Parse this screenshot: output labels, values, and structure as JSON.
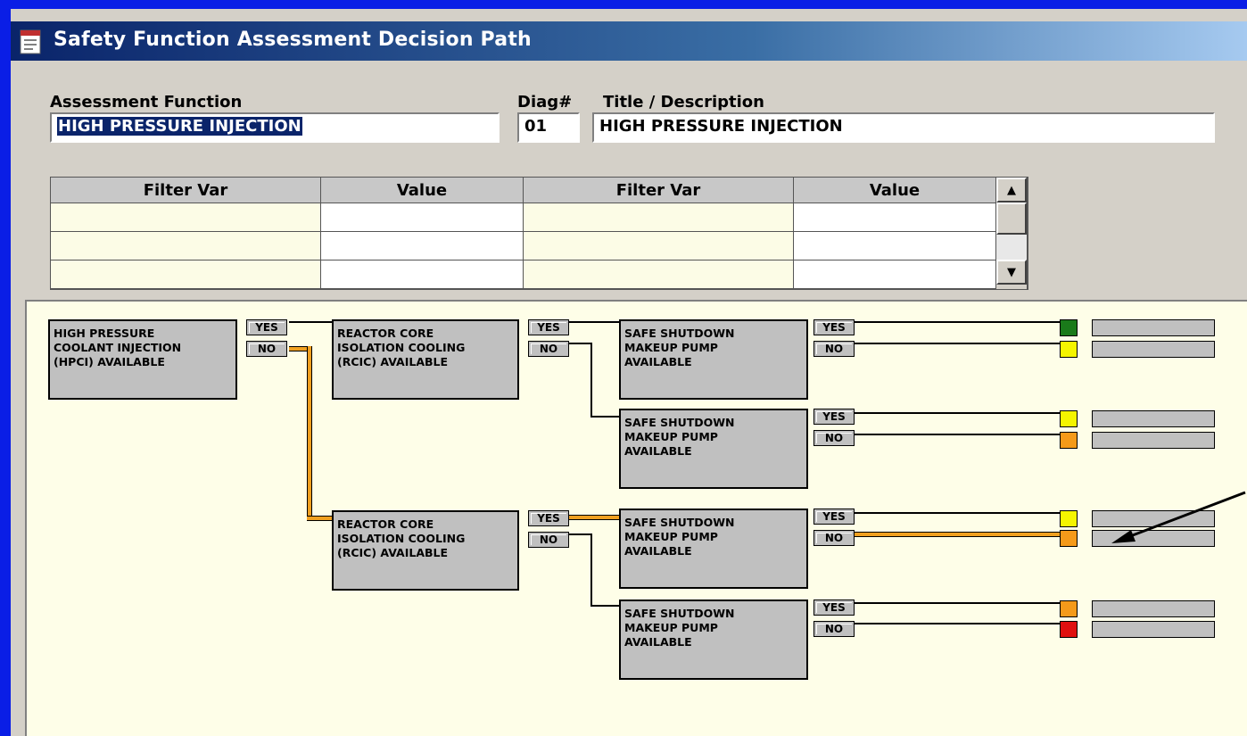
{
  "window": {
    "title": "Safety Function Assessment Decision Path"
  },
  "form": {
    "assessment_function_label": "Assessment Function",
    "assessment_function_value": "HIGH PRESSURE INJECTION",
    "diag_label": "Diag#",
    "diag_value": "01",
    "title_label": "Title / Description",
    "title_value": "HIGH PRESSURE INJECTION"
  },
  "filter_grid": {
    "headers": [
      "Filter Var",
      "Value",
      "Filter Var",
      "Value"
    ]
  },
  "yes_label": "YES",
  "no_label": "NO",
  "colors": {
    "green": "#1a7a1a",
    "yellow": "#f5f500",
    "orange": "#f59a1a",
    "red": "#e01010",
    "highlight_path": "#f0a020"
  },
  "diagram": {
    "root": {
      "text": "HIGH PRESSURE\nCOOLANT INJECTION\n(HPCI) AVAILABLE"
    },
    "level2": [
      {
        "text": "REACTOR CORE\nISOLATION COOLING\n(RCIC) AVAILABLE"
      },
      {
        "text": "REACTOR CORE\nISOLATION COOLING\n(RCIC) AVAILABLE"
      }
    ],
    "level3": [
      {
        "text": "SAFE SHUTDOWN\nMAKEUP PUMP\nAVAILABLE",
        "yes_status": "green",
        "no_status": "yellow"
      },
      {
        "text": "SAFE SHUTDOWN\nMAKEUP PUMP\nAVAILABLE",
        "yes_status": "yellow",
        "no_status": "orange"
      },
      {
        "text": "SAFE SHUTDOWN\nMAKEUP PUMP\nAVAILABLE",
        "yes_status": "yellow",
        "no_status": "orange"
      },
      {
        "text": "SAFE SHUTDOWN\nMAKEUP PUMP\nAVAILABLE",
        "yes_status": "orange",
        "no_status": "red"
      }
    ]
  }
}
